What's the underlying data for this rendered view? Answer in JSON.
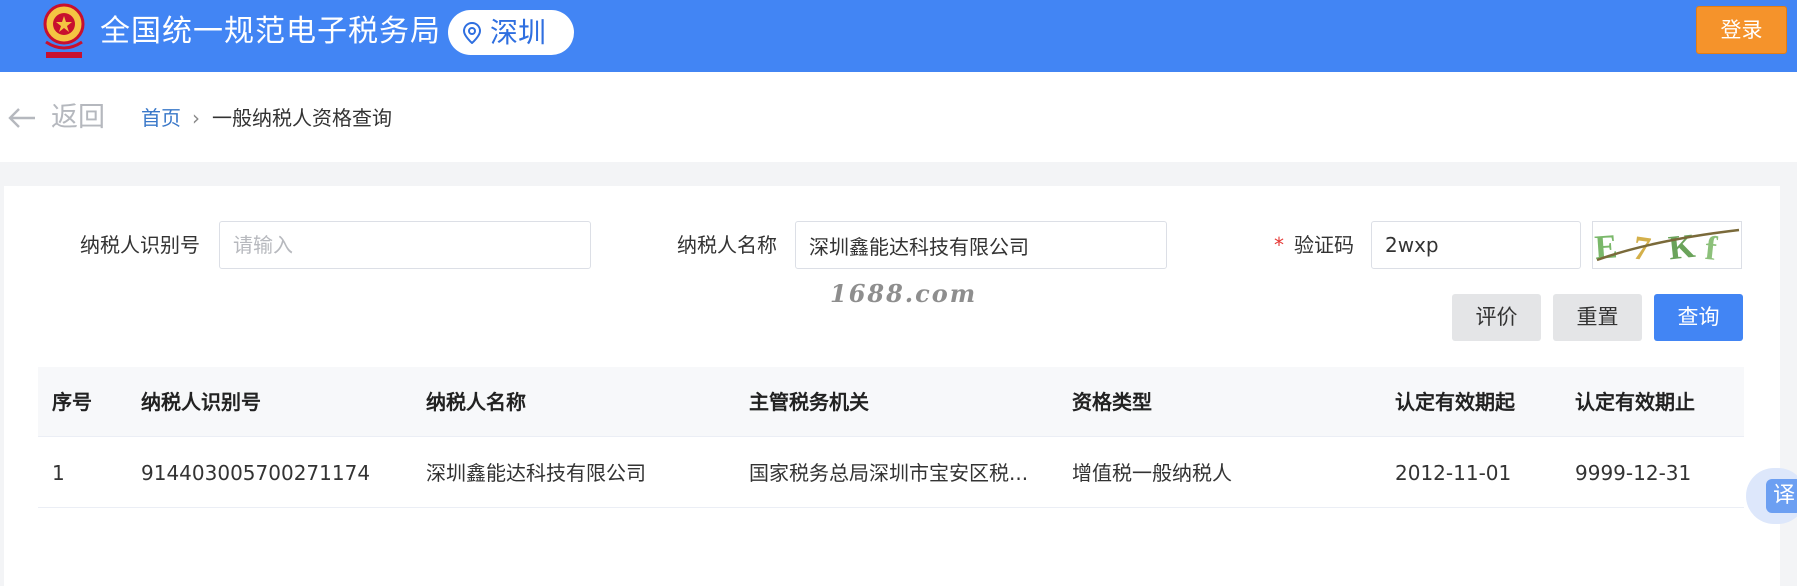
{
  "header": {
    "title": "全国统一规范电子税务局",
    "city": "深圳",
    "login_label": "登录",
    "colors": {
      "bar": "#4285f4",
      "login": "#f5932b"
    }
  },
  "breadcrumb": {
    "back_label": "返回",
    "home": "首页",
    "separator": "›",
    "current": "一般纳税人资格查询"
  },
  "form": {
    "taxpayer_id": {
      "label": "纳税人识别号",
      "placeholder": "请输入",
      "value": ""
    },
    "taxpayer_name": {
      "label": "纳税人名称",
      "value": "深圳鑫能达科技有限公司"
    },
    "captcha": {
      "required_mark": "*",
      "label": "验证码",
      "value": "2wxp",
      "image_text": "E7Kf"
    }
  },
  "watermark": "1688.com",
  "buttons": {
    "evaluate": "评价",
    "reset": "重置",
    "query": "查询"
  },
  "table": {
    "columns": [
      "序号",
      "纳税人识别号",
      "纳税人名称",
      "主管税务机关",
      "资格类型",
      "认定有效期起",
      "认定有效期止"
    ],
    "rows": [
      [
        "1",
        "914403005700271174",
        "深圳鑫能达科技有限公司",
        "国家税务总局深圳市宝安区税...",
        "增值税一般纳税人",
        "2012-11-01",
        "9999-12-31"
      ]
    ]
  },
  "translate_label": "译"
}
